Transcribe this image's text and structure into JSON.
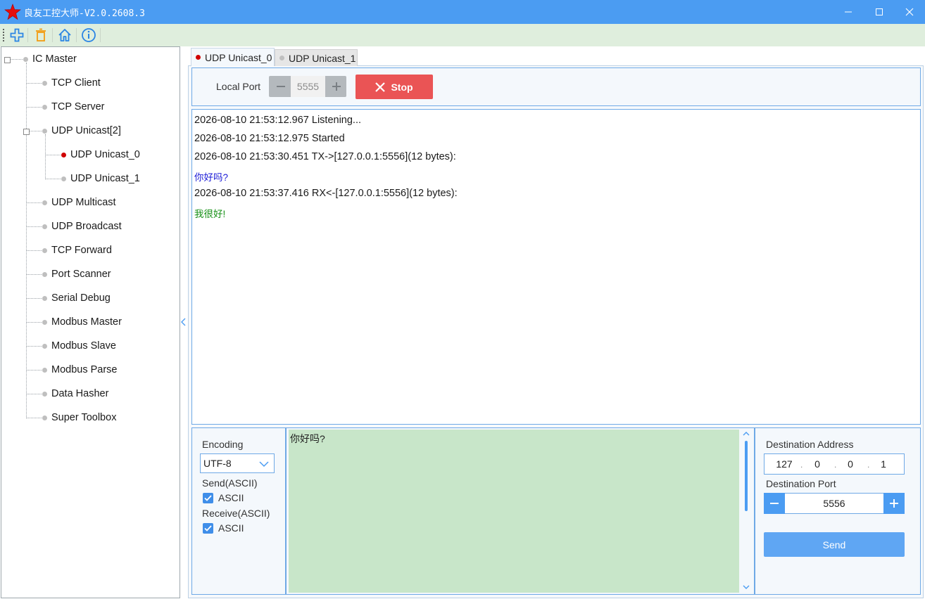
{
  "window": {
    "title": "良友工控大师-V2.0.2608.3",
    "controls": [
      "minimize-icon",
      "maximize-icon",
      "close-icon"
    ]
  },
  "toolbar": {
    "buttons": [
      "add-icon",
      "delete-icon",
      "home-icon",
      "info-icon"
    ]
  },
  "tree": {
    "root": "IC Master",
    "items": [
      {
        "label": "TCP Client"
      },
      {
        "label": "TCP Server"
      },
      {
        "label": "UDP Unicast[2]",
        "children": [
          {
            "label": "UDP Unicast_0",
            "status": "active"
          },
          {
            "label": "UDP Unicast_1",
            "status": "inactive"
          }
        ]
      },
      {
        "label": "UDP Multicast"
      },
      {
        "label": "UDP Broadcast"
      },
      {
        "label": "TCP Forward"
      },
      {
        "label": "Port Scanner"
      },
      {
        "label": "Serial Debug"
      },
      {
        "label": "Modbus Master"
      },
      {
        "label": "Modbus Slave"
      },
      {
        "label": "Modbus Parse"
      },
      {
        "label": "Data Hasher"
      },
      {
        "label": "Super Toolbox"
      }
    ]
  },
  "tabs": [
    {
      "label": "UDP Unicast_0",
      "selected": true
    },
    {
      "label": "UDP Unicast_1",
      "selected": false
    }
  ],
  "port_bar": {
    "label": "Local Port",
    "value": "5555",
    "stop_label": "Stop"
  },
  "log": [
    {
      "text": "2026-08-10 21:53:12.967 Listening...",
      "type": "info"
    },
    {
      "text": "2026-08-10 21:53:12.975 Started",
      "type": "info"
    },
    {
      "text": "2026-08-10 21:53:30.451 TX->[127.0.0.1:5556](12 bytes):",
      "type": "info"
    },
    {
      "text": "你好吗?",
      "type": "tx"
    },
    {
      "text": "2026-08-10 21:53:37.416 RX<-[127.0.0.1:5556](12 bytes):",
      "type": "info"
    },
    {
      "text": "我很好!",
      "type": "rx"
    }
  ],
  "encoding": {
    "label": "Encoding",
    "value": "UTF-8",
    "send_label": "Send(ASCII)",
    "send_checkbox": "ASCII",
    "receive_label": "Receive(ASCII)",
    "receive_checkbox": "ASCII"
  },
  "message": {
    "value": "你好吗?"
  },
  "destination": {
    "address_label": "Destination Address",
    "ip": [
      "127",
      "0",
      "0",
      "1"
    ],
    "port_label": "Destination Port",
    "port": "5556",
    "send_label": "Send"
  },
  "colors": {
    "titlebar": "#4b9cf2",
    "toolbar": "#dfeedd",
    "stop": "#ea5455",
    "message_bg": "#c8e6c9",
    "tx_text": "#1a1ad6",
    "rx_text": "#169016",
    "active_dot": "#d00000"
  }
}
